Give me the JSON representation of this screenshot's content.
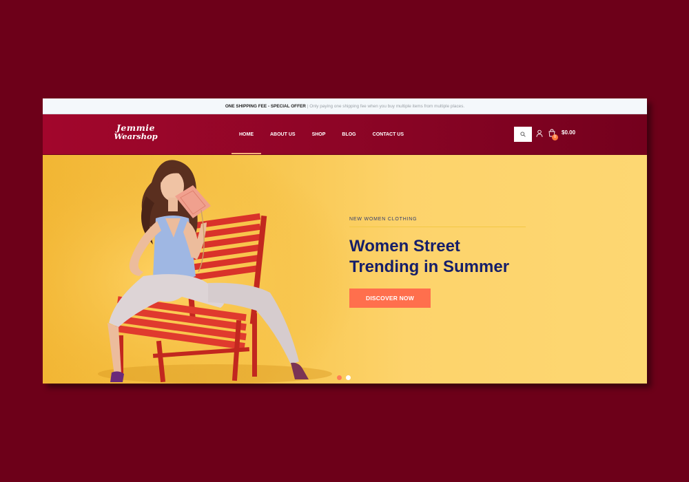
{
  "topbar": {
    "offer_title": "ONE SHIPPING FEE - SPECIAL OFFER",
    "offer_text": "| Only paying one shipping fee when you buy multiple items from multiple places."
  },
  "header": {
    "logo_line1": "Jemmie",
    "logo_line2": "Wearshop",
    "nav": [
      {
        "label": "HOME",
        "active": true
      },
      {
        "label": "ABOUT US"
      },
      {
        "label": "SHOP"
      },
      {
        "label": "BLOG"
      },
      {
        "label": "CONTACT US"
      }
    ],
    "cart_count": "0",
    "cart_total": "$0.00"
  },
  "hero": {
    "kicker": "NEW WOMEN CLOTHING",
    "title_line1": "Women Street",
    "title_line2": "Trending in Summer",
    "button_label": "DISCOVER NOW",
    "slides": 2,
    "active_slide": 1
  },
  "colors": {
    "page_bg": "#6d0019",
    "header_bg": "#8d0526",
    "hero_bg": "#fdd36b",
    "title": "#151e6a",
    "button": "#ff6f4d",
    "chair": "#d9322a"
  }
}
